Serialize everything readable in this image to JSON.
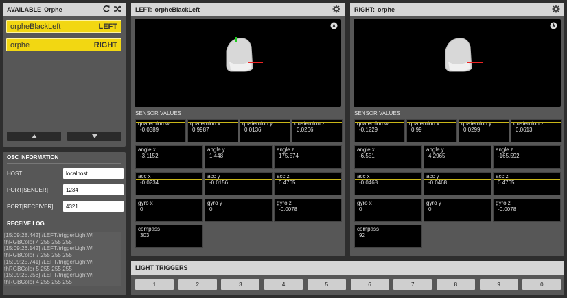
{
  "available": {
    "header_label": "AVAILABLE",
    "header_name": "Orphe",
    "devices": [
      {
        "name": "orpheBlackLeft",
        "side": "LEFT"
      },
      {
        "name": "orphe",
        "side": "RIGHT"
      }
    ]
  },
  "osc": {
    "title": "OSC INFORMATION",
    "host_label": "HOST",
    "host_value": "localhost",
    "sender_label": "PORT[SENDER]",
    "sender_value": "1234",
    "receiver_label": "PORT[RECEIVER]",
    "receiver_value": "4321",
    "log_title": "RECEIVE LOG",
    "log_lines": [
      "[15:09:28.442]  /LEFT/triggerLightWi",
      "thRGBColor  4  255  255  255",
      "[15:09:26.142]  /LEFT/triggerLightWi",
      "thRGBColor  7  255  255  255",
      "[15:09:25.741]  /LEFT/triggerLightWi",
      "thRGBColor  5  255  255  255",
      "[15:09:25.258]  /LEFT/triggerLightWi",
      "thRGBColor  4  255  255  255",
      "[15:09:24.858]  /LEFT/triggerLightWi"
    ]
  },
  "left": {
    "header_label": "LEFT:",
    "header_name": "orpheBlackLeft",
    "sensor_title": "SENSOR VALUES",
    "sensors": {
      "qw": {
        "label": "quaternion w",
        "value": "-0.0389"
      },
      "qx": {
        "label": "quaternion x",
        "value": "0.9987"
      },
      "qy": {
        "label": "quaternion y",
        "value": "0.0136"
      },
      "qz": {
        "label": "quaternion z",
        "value": "0.0266"
      },
      "ax": {
        "label": "angle x",
        "value": "-3.1152"
      },
      "ay": {
        "label": "angle y",
        "value": "1.448"
      },
      "az": {
        "label": "angle z",
        "value": "175.574"
      },
      "cx": {
        "label": "acc x",
        "value": "-0.0234"
      },
      "cy": {
        "label": "acc y",
        "value": "-0.0156"
      },
      "cz": {
        "label": "acc z",
        "value": "0.4765"
      },
      "gx": {
        "label": "gyro x",
        "value": "0"
      },
      "gy": {
        "label": "gyro y",
        "value": "0"
      },
      "gz": {
        "label": "gyro z",
        "value": "-0.0078"
      },
      "cp": {
        "label": "compass",
        "value": "303"
      }
    }
  },
  "right": {
    "header_label": "RIGHT:",
    "header_name": "orphe",
    "sensor_title": "SENSOR VALUES",
    "sensors": {
      "qw": {
        "label": "quaternion w",
        "value": "-0.1229"
      },
      "qx": {
        "label": "quaternion x",
        "value": "0.99"
      },
      "qy": {
        "label": "quaternion y",
        "value": "0.0299"
      },
      "qz": {
        "label": "quaternion z",
        "value": "0.0613"
      },
      "ax": {
        "label": "angle x",
        "value": "-6.551"
      },
      "ay": {
        "label": "angle y",
        "value": "4.2965"
      },
      "az": {
        "label": "angle z",
        "value": "-165.592"
      },
      "cx": {
        "label": "acc x",
        "value": "-0.0468"
      },
      "cy": {
        "label": "acc y",
        "value": "-0.0468"
      },
      "cz": {
        "label": "acc z",
        "value": "0.4765"
      },
      "gx": {
        "label": "gyro x",
        "value": "0"
      },
      "gy": {
        "label": "gyro y",
        "value": "0"
      },
      "gz": {
        "label": "gyro z",
        "value": "-0.0078"
      },
      "cp": {
        "label": "compass",
        "value": "92"
      }
    }
  },
  "triggers": {
    "title": "LIGHT TRIGGERS",
    "buttons": [
      "1",
      "2",
      "3",
      "4",
      "5",
      "6",
      "7",
      "8",
      "9",
      "0"
    ]
  },
  "colors": {
    "accent_yellow": "#f2d712",
    "trace_yellow": "#c9b618",
    "panel_bg": "#575757",
    "header_bg": "#d6d6d6"
  },
  "icons": {
    "refresh": "refresh-icon",
    "shuffle": "shuffle-icon",
    "settings": "gear-icon",
    "compass": "compass-icon",
    "up": "arrow-up-icon",
    "down": "arrow-down-icon"
  }
}
